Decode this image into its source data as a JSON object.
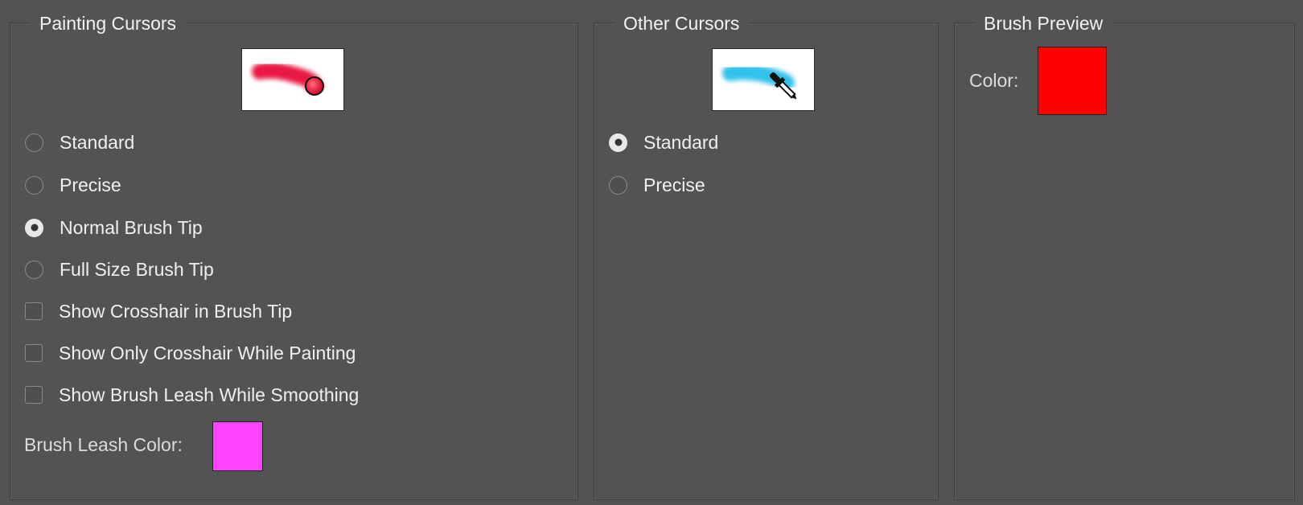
{
  "painting_cursors": {
    "title": "Painting Cursors",
    "preview_icon": "brush-tip-cursor-icon",
    "options": [
      {
        "label": "Standard",
        "checked": false
      },
      {
        "label": "Precise",
        "checked": false
      },
      {
        "label": "Normal Brush Tip",
        "checked": true
      },
      {
        "label": "Full Size Brush Tip",
        "checked": false
      }
    ],
    "checkboxes": [
      {
        "label": "Show Crosshair in Brush Tip",
        "checked": false
      },
      {
        "label": "Show Only Crosshair While Painting",
        "checked": false
      },
      {
        "label": "Show Brush Leash While Smoothing",
        "checked": false
      }
    ],
    "leash_color_label": "Brush Leash Color:",
    "leash_color": "#ff44ff"
  },
  "other_cursors": {
    "title": "Other Cursors",
    "preview_icon": "eyedropper-cursor-icon",
    "options": [
      {
        "label": "Standard",
        "checked": true
      },
      {
        "label": "Precise",
        "checked": false
      }
    ]
  },
  "brush_preview": {
    "title": "Brush Preview",
    "color_label": "Color:",
    "color": "#ff0000"
  }
}
